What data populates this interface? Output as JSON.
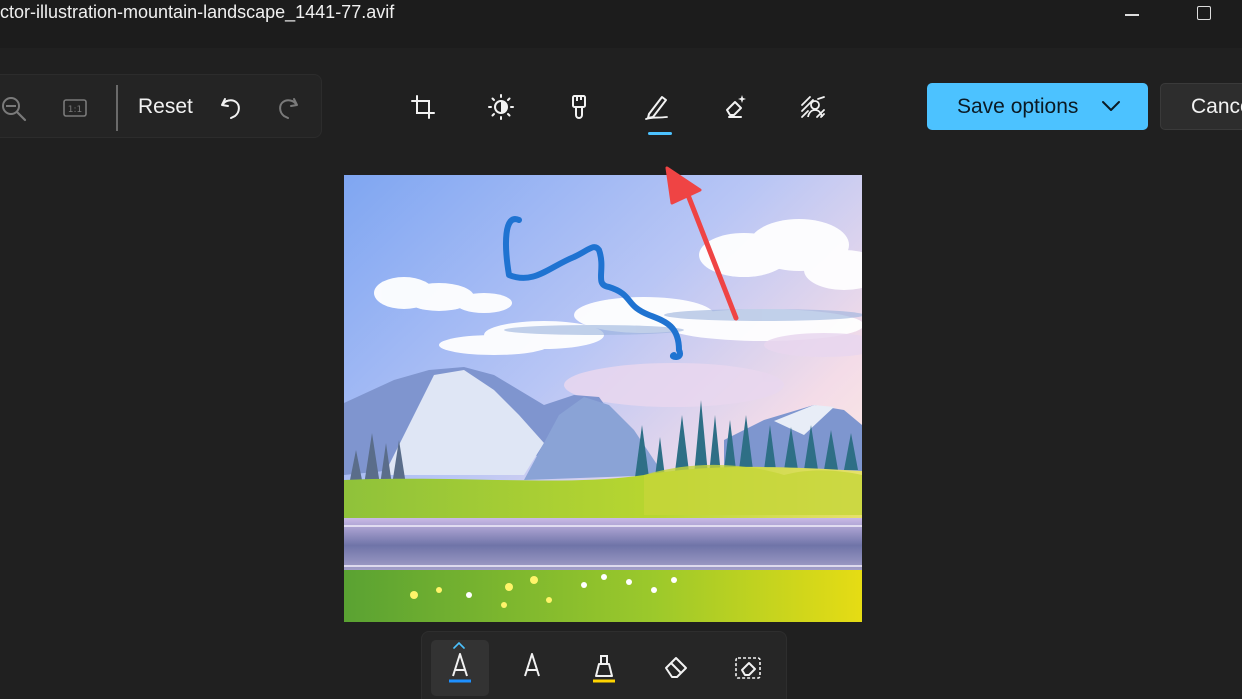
{
  "window": {
    "title": "ctor-illustration-mountain-landscape_1441-77.avif"
  },
  "left_toolbar": {
    "zoom_out_icon": "zoom-out-icon",
    "actual_size_icon": "actual-size-icon",
    "reset_label": "Reset",
    "undo_icon": "undo-icon",
    "redo_icon": "redo-icon"
  },
  "edit_tabs": [
    {
      "name": "crop",
      "icon": "crop-icon",
      "active": false
    },
    {
      "name": "adjustment",
      "icon": "brightness-icon",
      "active": false
    },
    {
      "name": "filter",
      "icon": "paintbrush-icon",
      "active": false
    },
    {
      "name": "markup",
      "icon": "pen-icon",
      "active": true
    },
    {
      "name": "erase",
      "icon": "eraser-sparkle-icon",
      "active": false
    },
    {
      "name": "background",
      "icon": "background-blur-icon",
      "active": false
    }
  ],
  "actions": {
    "save_label": "Save options",
    "cancel_label": "Cancel"
  },
  "markup_tools": [
    {
      "name": "ballpoint-pen-1",
      "color": "#1e90ff",
      "active": true
    },
    {
      "name": "ballpoint-pen-2",
      "color": "#ffffff",
      "active": false
    },
    {
      "name": "highlighter",
      "color": "#ffd400",
      "active": false
    },
    {
      "name": "eraser",
      "active": false
    },
    {
      "name": "erase-all",
      "active": false
    }
  ],
  "colors": {
    "accent": "#4cc2ff",
    "background": "#202020",
    "annotation_arrow": "#ef4444",
    "drawn_stroke": "#1f73d1"
  }
}
